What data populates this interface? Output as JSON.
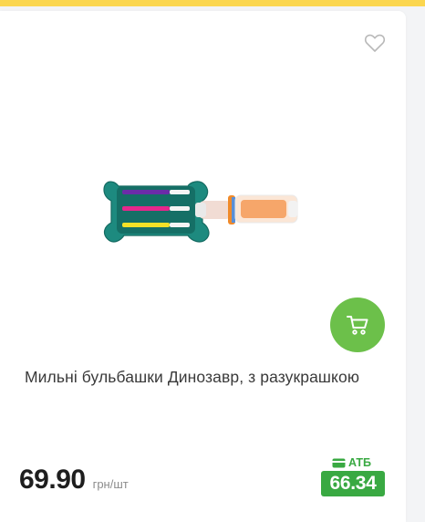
{
  "product": {
    "title": "Мильні бульбашки Динозавр, з разукрашкою",
    "price": "69.90",
    "unit": "грн/шт",
    "promo_label": "АТБ",
    "promo_price": "66.34"
  },
  "icons": {
    "favorite": "heart-icon",
    "cart": "cart-icon",
    "card": "card-icon"
  },
  "colors": {
    "accent_stripe": "#fbd64f",
    "cart_button": "#6cc04a",
    "promo_green": "#39a942"
  }
}
